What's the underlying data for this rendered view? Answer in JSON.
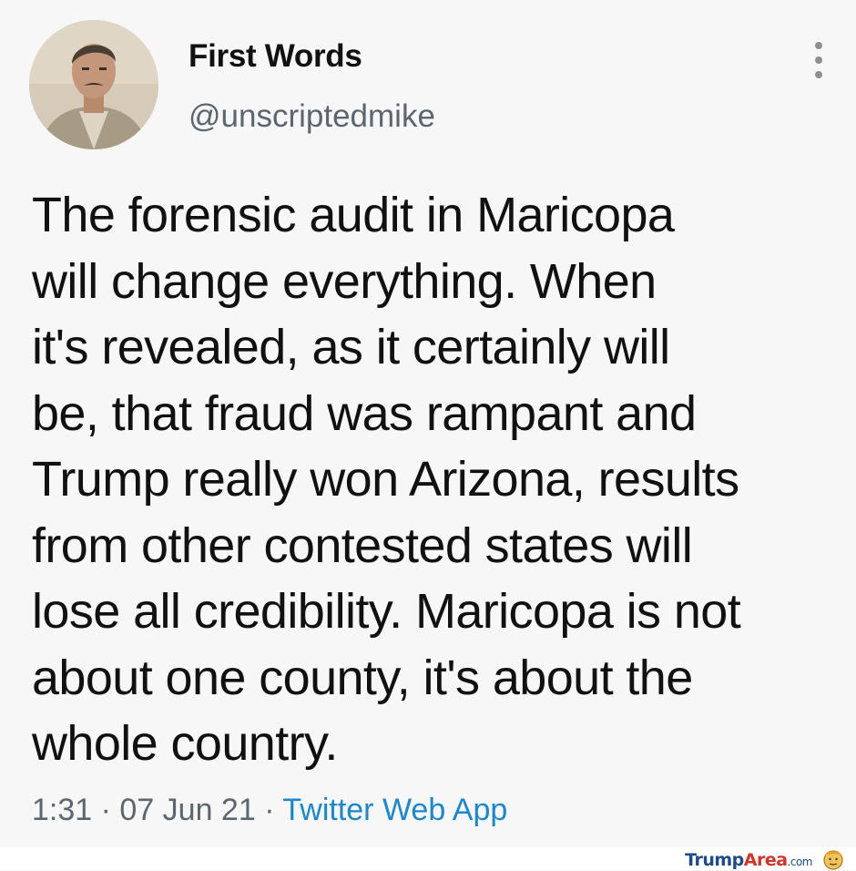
{
  "tweet": {
    "display_name": "First Words",
    "handle": "@unscriptedmike",
    "text_lines": [
      "The forensic audit in Maricopa",
      "will change everything. When",
      "it's revealed, as it certainly will",
      "be, that fraud was rampant and",
      "Trump really won Arizona, results",
      "from other contested states will",
      "lose all credibility. Maricopa is not",
      "about one county, it's about the",
      "whole country."
    ],
    "time": "1:31",
    "separator": " · ",
    "date": "07 Jun 21",
    "source": "Twitter Web App"
  },
  "watermark": {
    "part1": "Trump",
    "part2": "Area",
    "part3": ".com"
  },
  "colors": {
    "source_link": "#1b87d0",
    "handle": "#5c6670",
    "text": "#111111"
  },
  "icons": {
    "more": "vertical-ellipsis",
    "avatar": "user-profile-photo",
    "watermark_logo": "trump-face-logo"
  }
}
